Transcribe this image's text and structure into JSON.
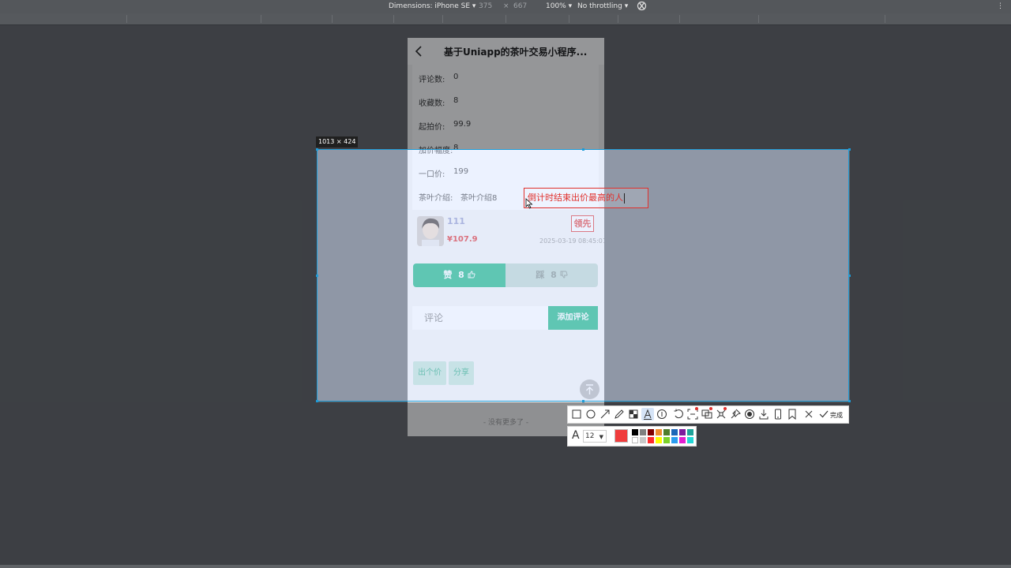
{
  "devtools": {
    "dimensions_label": "Dimensions: iPhone SE",
    "width": "375",
    "times": "×",
    "height": "667",
    "zoom": "100%",
    "throttle": "No throttling",
    "more": "⋮"
  },
  "phone": {
    "title": "基于Uniapp的茶叶交易小程序...",
    "info": [
      {
        "label": "评论数:",
        "value": "0"
      },
      {
        "label": "收藏数:",
        "value": "8"
      },
      {
        "label": "起拍价:",
        "value": "99.9"
      },
      {
        "label": "加价幅度:",
        "value": "8"
      },
      {
        "label": "一口价:",
        "value": "199"
      },
      {
        "label": "茶叶介绍:",
        "value": "茶叶介绍8"
      }
    ],
    "bid": {
      "bidder": "111",
      "price": "¥107.9",
      "status": "领先",
      "time": "2025-03-19 08:45:01"
    },
    "like": {
      "label": "赞",
      "count": "8"
    },
    "dislike": {
      "label": "踩",
      "count": "8"
    },
    "comment_placeholder": "评论",
    "add_comment": "添加评论",
    "bid_button": "出个价",
    "share_button": "分享",
    "no_more": "- 没有更多了 -"
  },
  "capture": {
    "selection_size": "1013 × 424",
    "annotation_text": "倒计时结束出价最高的人",
    "done_label": "完成",
    "font_size": "12",
    "current_color": "#f03c3c",
    "palette": [
      "#000000",
      "#808080",
      "#800000",
      "#ef8c2f",
      "#4f7d2c",
      "#1c66b8",
      "#7d1c9e",
      "#1ea39a",
      "#ffffff",
      "#c8c8c8",
      "#ff2b2b",
      "#ffff00",
      "#7cd22a",
      "#2a9cf0",
      "#e21fd0",
      "#22d6d6"
    ]
  },
  "colors": {
    "accent_green": "#0db47c",
    "annotation_red": "#e0302c",
    "selection_blue": "#1e9bd7"
  }
}
